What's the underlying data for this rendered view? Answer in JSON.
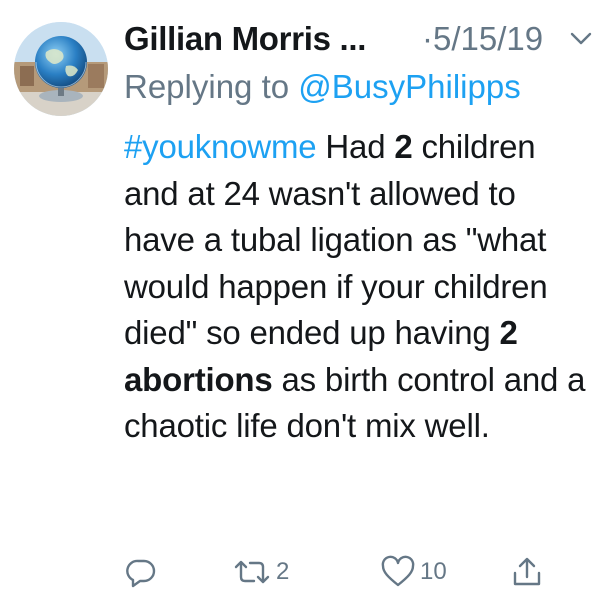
{
  "tweet": {
    "author_name": "Gillian Morris ...",
    "separator_dot": "·",
    "date": "5/15/19",
    "replying_prefix": "Replying to ",
    "replying_handle": "@BusyPhilipps",
    "text": {
      "hashtag": "#youknowme",
      "part1": " Had ",
      "bold1": "2",
      "part2": " children and at 24 wasn't allowed to have a tubal ligation as \"what would happen if your children died\" so ended up having ",
      "bold2": "2 abortions",
      "part3": " as birth control and a chaotic life don't mix well."
    }
  },
  "actions": {
    "reply_icon": "reply-icon",
    "retweet_icon": "retweet-icon",
    "retweet_count": "2",
    "like_icon": "heart-icon",
    "like_count": "10",
    "share_icon": "share-icon"
  },
  "colors": {
    "link": "#1da1f2",
    "muted": "#657786",
    "text": "#14171a",
    "background": "#ffffff"
  }
}
